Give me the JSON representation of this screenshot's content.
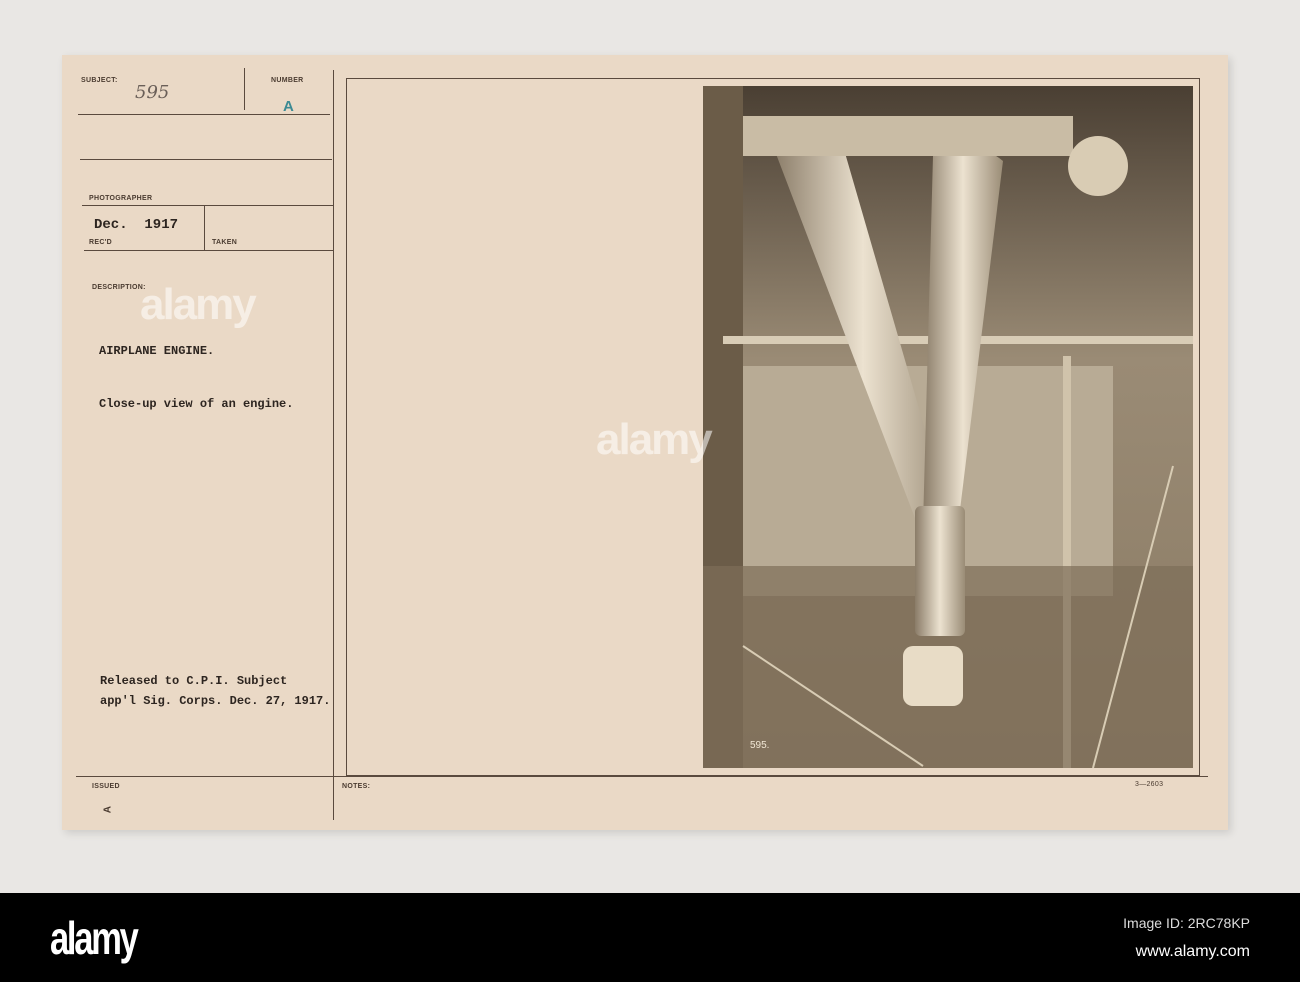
{
  "card": {
    "subject_label": "SUBJECT:",
    "subject_value": "595",
    "number_label": "NUMBER",
    "number_value": "A",
    "photographer_label": "PHOTOGRAPHER",
    "recd_value": "Dec.  1917",
    "recd_label": "REC'D",
    "taken_label": "TAKEN",
    "description_label": "DESCRIPTION:",
    "title": "AIRPLANE ENGINE.",
    "description": "Close-up view of an engine.",
    "release_line1": "Released to C.P.I. Subject",
    "release_line2": "app'l Sig. Corps. Dec. 27, 1917.",
    "issued_label": "ISSUED",
    "notes_label": "NOTES:",
    "form_number": "3—2603",
    "corner_mark": "A",
    "photo_caption": "595."
  },
  "watermark": "alamy",
  "banner": {
    "logo": "alamy",
    "image_id": "Image ID: 2RC78KP",
    "url": "www.alamy.com"
  },
  "colors": {
    "card": "#ead9c6",
    "banner": "#000000",
    "stamp": "#3c8a93"
  }
}
